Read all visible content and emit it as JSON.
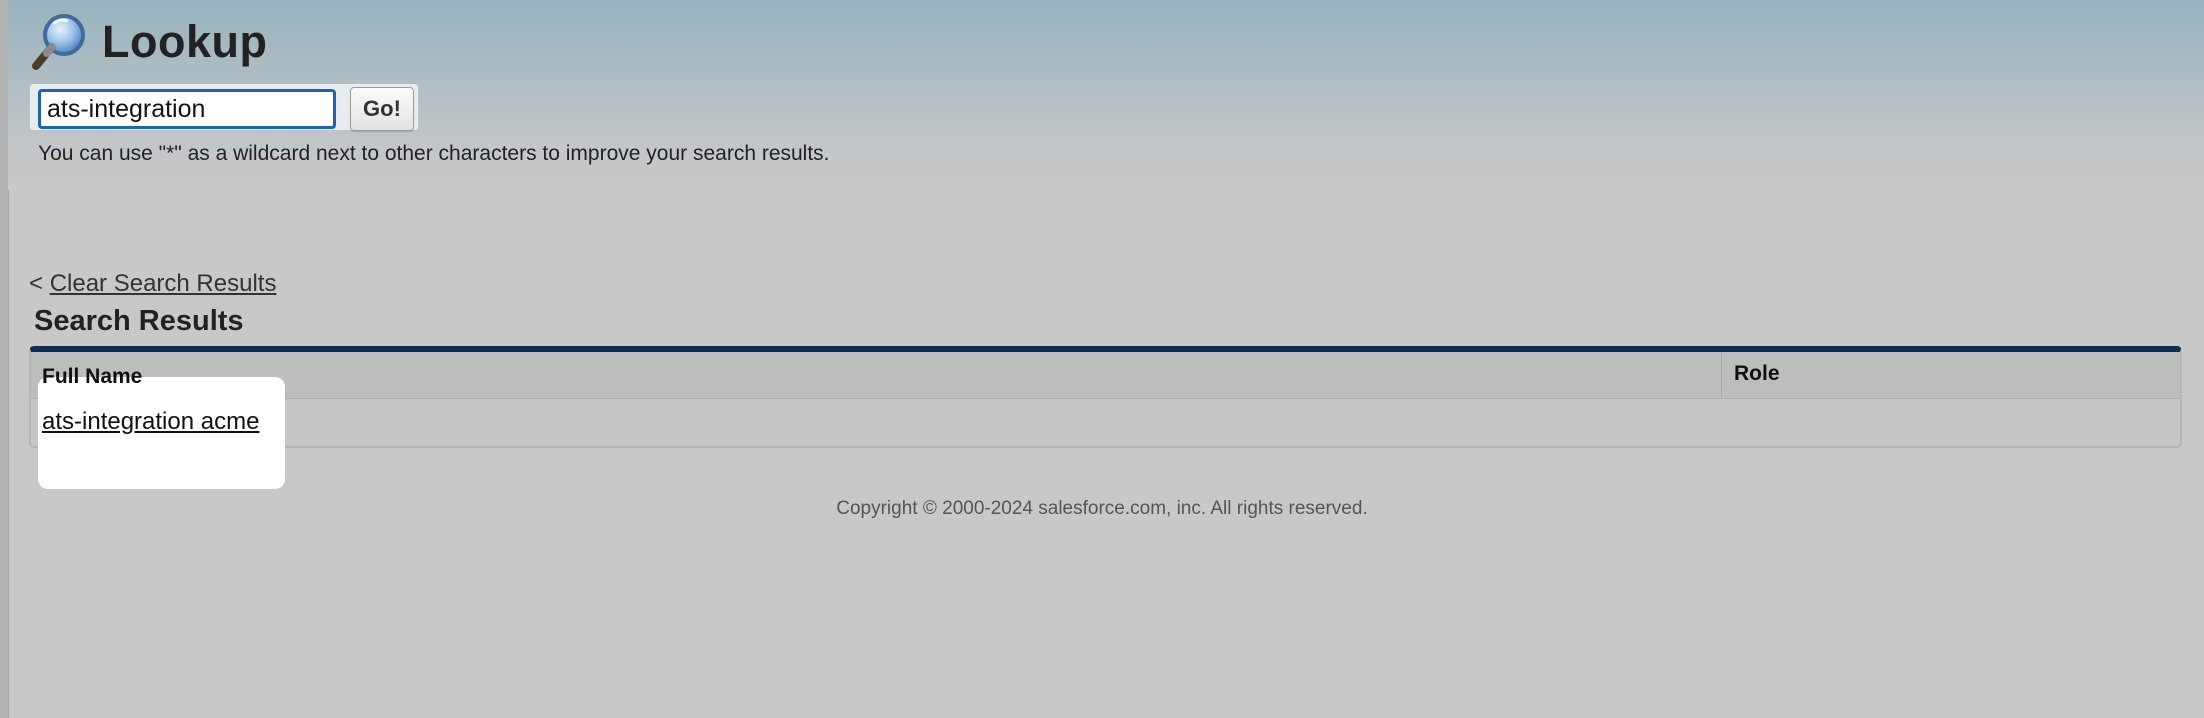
{
  "header": {
    "title": "Lookup",
    "icon": "magnifier-icon"
  },
  "search": {
    "value": "ats-integration",
    "go_label": "Go!",
    "hint": "You can use \"*\" as a wildcard next to other characters to improve your search results."
  },
  "results": {
    "clear_prefix": "<",
    "clear_label": "Clear Search Results",
    "title": "Search Results",
    "columns": [
      "Full Name",
      "Role"
    ],
    "rows": [
      {
        "full_name": "ats-integration acme",
        "role": ""
      }
    ]
  },
  "footer": {
    "copyright": "Copyright © 2000-2024 salesforce.com, inc. All rights reserved."
  },
  "colors": {
    "accent_border": "#0f2c57",
    "input_focus": "#1c63b7",
    "background": "#c8c8c8"
  }
}
